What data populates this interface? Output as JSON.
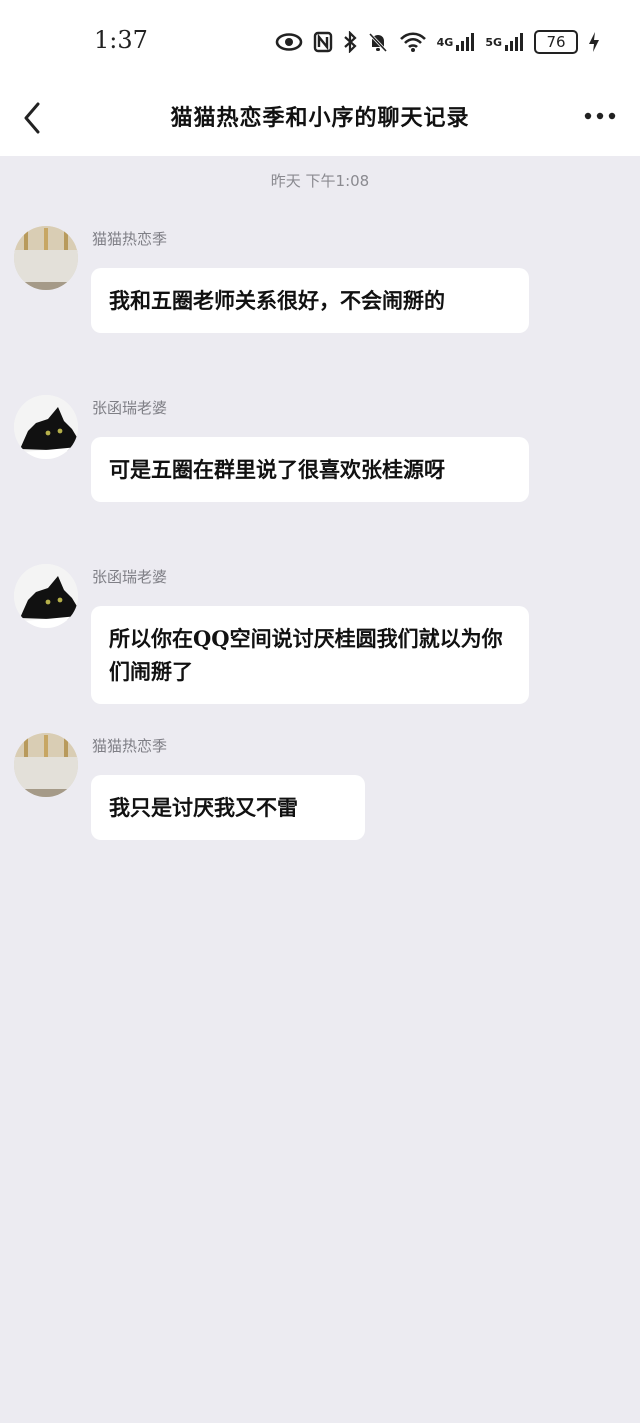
{
  "status_bar": {
    "time": "1:37",
    "net_4g": "4G",
    "net_5g": "5G",
    "battery": "76",
    "icons": [
      "eye-icon",
      "nfc-icon",
      "bluetooth-icon",
      "bell-off-icon",
      "wifi-icon",
      "signal-4g-icon",
      "signal-5g-icon",
      "battery-icon",
      "charging-icon"
    ]
  },
  "header": {
    "title": "猫猫热恋季和小序的聊天记录",
    "back_icon": "chevron-left-icon",
    "more_icon": "more-dots-icon"
  },
  "chat": {
    "timestamp": "昨天 下午1:08",
    "messages": [
      {
        "sender": "猫猫热恋季",
        "avatar": "avatar-room",
        "text": "我和五圈老师关系很好，不会闹掰的"
      },
      {
        "sender": "张函瑞老婆",
        "avatar": "avatar-black-cat",
        "text": "可是五圈在群里说了很喜欢张桂源呀"
      },
      {
        "sender": "张函瑞老婆",
        "avatar": "avatar-black-cat",
        "text": "所以你在QQ空间说讨厌桂圆我们就以为你们闹掰了"
      },
      {
        "sender": "猫猫热恋季",
        "avatar": "avatar-room",
        "text": "我只是讨厌我又不雷"
      }
    ]
  },
  "colors": {
    "background": "#ecebf1",
    "bubble": "#ffffff",
    "sender_text": "#7f7f86",
    "timestamp_text": "#8a8a90"
  }
}
